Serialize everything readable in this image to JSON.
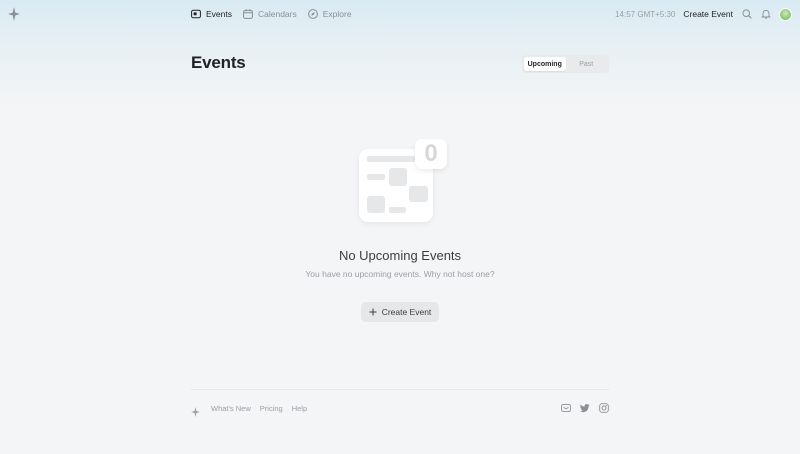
{
  "nav": {
    "items": [
      {
        "label": "Events",
        "icon": "ticket-icon",
        "active": true
      },
      {
        "label": "Calendars",
        "icon": "calendar-icon",
        "active": false
      },
      {
        "label": "Explore",
        "icon": "compass-icon",
        "active": false
      }
    ]
  },
  "topbar": {
    "clock": "14:57 GMT+5:30",
    "create_label": "Create Event",
    "icons": [
      "search-icon",
      "bell-icon",
      "avatar"
    ]
  },
  "page": {
    "title": "Events",
    "tabs": [
      {
        "label": "Upcoming",
        "active": true
      },
      {
        "label": "Past",
        "active": false
      }
    ]
  },
  "empty": {
    "count": "0",
    "title": "No Upcoming Events",
    "subtitle": "You have no upcoming events. Why not host one?",
    "button_label": "Create Event"
  },
  "footer": {
    "links": [
      "What's New",
      "Pricing",
      "Help"
    ],
    "social": [
      "mail-icon",
      "twitter-icon",
      "instagram-icon"
    ]
  },
  "colors": {
    "background": "#f4f5f6",
    "gradient_top": "#d9eaf3",
    "text_primary": "#1f2124",
    "text_muted": "#9a9fa6"
  }
}
